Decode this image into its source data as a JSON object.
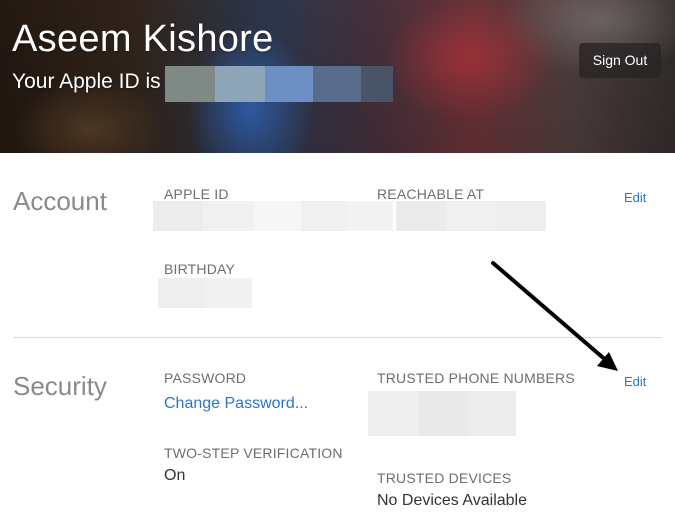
{
  "header": {
    "user_name": "Aseem Kishore",
    "apple_id_prefix": "Your Apple ID is",
    "sign_out_label": "Sign Out"
  },
  "account": {
    "section_title": "Account",
    "apple_id_label": "APPLE ID",
    "reachable_at_label": "REACHABLE AT",
    "birthday_label": "BIRTHDAY",
    "edit_label": "Edit"
  },
  "security": {
    "section_title": "Security",
    "password_label": "PASSWORD",
    "change_password_link": "Change Password...",
    "two_step_label": "TWO-STEP VERIFICATION",
    "two_step_value": "On",
    "trusted_phone_label": "TRUSTED PHONE NUMBERS",
    "trusted_devices_label": "TRUSTED DEVICES",
    "trusted_devices_value": "No Devices Available",
    "edit_label": "Edit"
  },
  "colors": {
    "link": "#2a77c9",
    "section_title": "#8a8a8a",
    "label": "#6e6e6e",
    "annotation_arrow": "#000000"
  }
}
